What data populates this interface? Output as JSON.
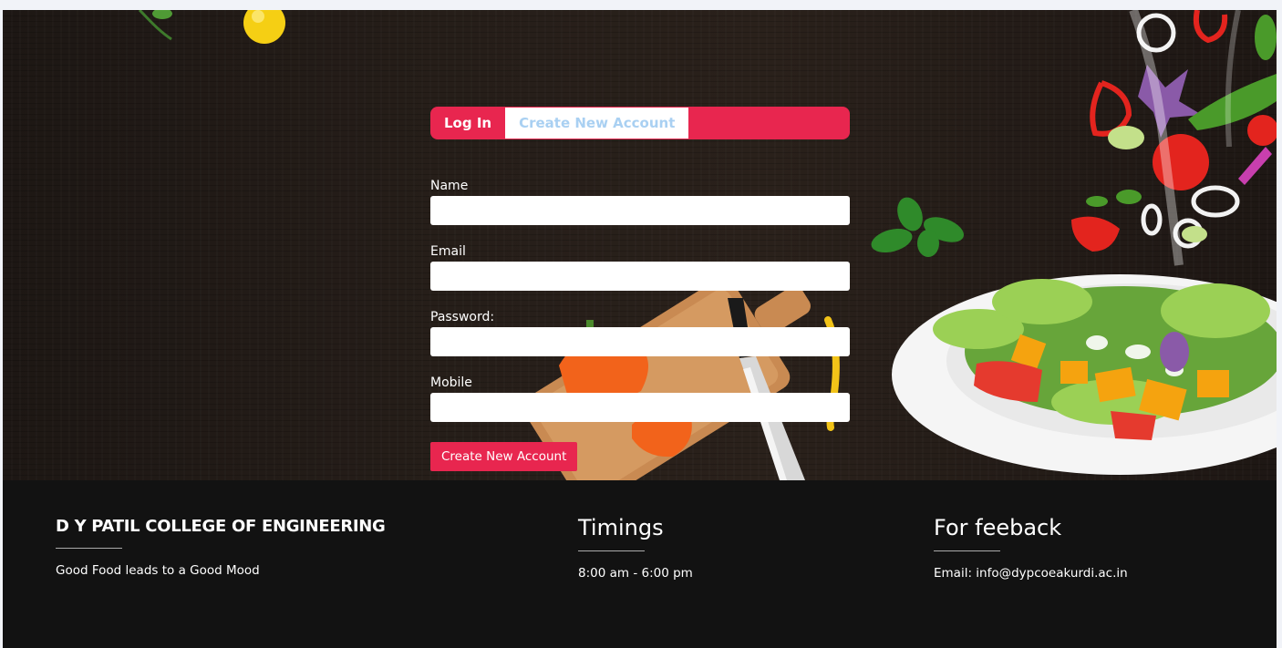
{
  "tabs": {
    "login_label": "Log In",
    "create_label": "Create New Account"
  },
  "form": {
    "fields": [
      {
        "label": "Name",
        "value": ""
      },
      {
        "label": "Email",
        "value": ""
      },
      {
        "label": "Password:",
        "value": ""
      },
      {
        "label": "Mobile",
        "value": ""
      }
    ],
    "submit_label": "Create New Account"
  },
  "footer": {
    "college": {
      "title": "D Y PATIL COLLEGE OF ENGINEERING",
      "tagline": "Good Food leads to a Good Mood"
    },
    "timings": {
      "title": "Timings",
      "text": "8:00 am - 6:00 pm"
    },
    "feedback": {
      "title": "For feeback",
      "text": "Email: info@dypcoeakurdi.ac.in"
    }
  },
  "colors": {
    "accent": "#e8264f",
    "hero_bg": "#261e19",
    "footer_bg": "#121212",
    "tab_inactive_text": "#a9d0f2"
  }
}
